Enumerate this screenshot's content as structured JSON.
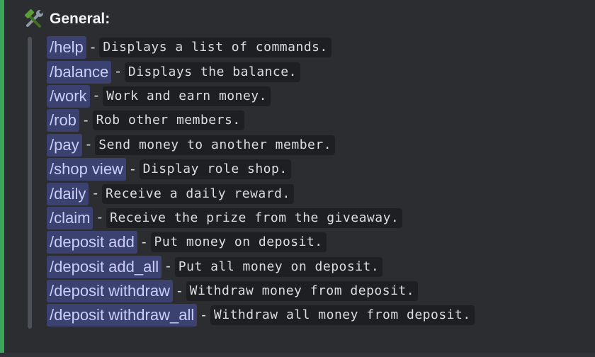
{
  "embed": {
    "accent_color": "#3ba55c",
    "field_title": "General:",
    "title_icon": "hammer-and-wrench-icon",
    "commands": [
      {
        "name": "/help",
        "desc": "Displays a list of commands."
      },
      {
        "name": "/balance",
        "desc": "Displays the balance."
      },
      {
        "name": "/work",
        "desc": "Work and earn money."
      },
      {
        "name": "/rob",
        "desc": "Rob other members."
      },
      {
        "name": "/pay",
        "desc": "Send money to another member."
      },
      {
        "name": "/shop view",
        "desc": "Display role shop."
      },
      {
        "name": "/daily",
        "desc": "Receive a daily reward."
      },
      {
        "name": "/claim",
        "desc": "Receive the prize from the giveaway."
      },
      {
        "name": "/deposit add",
        "desc": "Put money on deposit."
      },
      {
        "name": "/deposit add_all",
        "desc": "Put all money on deposit."
      },
      {
        "name": "/deposit withdraw",
        "desc": "Withdraw money from deposit."
      },
      {
        "name": "/deposit withdraw_all",
        "desc": "Withdraw all money from deposit."
      }
    ],
    "separator": "-"
  }
}
